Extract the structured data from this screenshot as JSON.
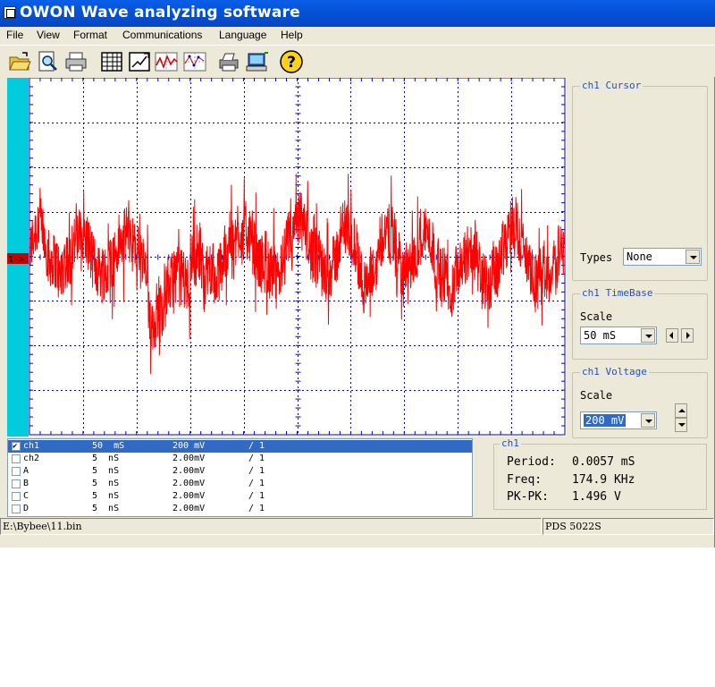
{
  "window": {
    "title": "OWON Wave analyzing software"
  },
  "menu": [
    "File",
    "View",
    "Format",
    "Communications",
    "Language",
    "Help"
  ],
  "toolbar": [
    {
      "icon": "open-folder-icon"
    },
    {
      "icon": "zoom-preview-icon"
    },
    {
      "icon": "printer-icon"
    },
    {
      "icon": "table-icon"
    },
    {
      "icon": "edit-chart-icon"
    },
    {
      "icon": "waveform-icon"
    },
    {
      "icon": "waveform-points-icon"
    },
    {
      "icon": "print-setup-icon"
    },
    {
      "icon": "device-connect-icon"
    },
    {
      "icon": "help-icon"
    }
  ],
  "scope": {
    "channel_marker": "1->",
    "trace_color": "#ff0000",
    "grid_color": "#0000cc",
    "left_bar_color": "#00ccdd"
  },
  "cursor_panel": {
    "title": "ch1 Cursor",
    "types_label": "Types",
    "types_value": "None"
  },
  "timebase_panel": {
    "title": "ch1 TimeBase",
    "scale_label": "Scale",
    "scale_value": "50 mS"
  },
  "voltage_panel": {
    "title": "ch1 Voltage",
    "scale_label": "Scale",
    "scale_value": "200 mV"
  },
  "channels": [
    {
      "name": "ch1",
      "time": "50  mS",
      "volt": "200 mV",
      "probe": "/ 1",
      "checked": true,
      "selected": true
    },
    {
      "name": "ch2",
      "time": "5  nS",
      "volt": "2.00mV",
      "probe": "/ 1",
      "checked": false,
      "selected": false
    },
    {
      "name": "A",
      "time": "5  nS",
      "volt": "2.00mV",
      "probe": "/ 1",
      "checked": false,
      "selected": false
    },
    {
      "name": "B",
      "time": "5  nS",
      "volt": "2.00mV",
      "probe": "/ 1",
      "checked": false,
      "selected": false
    },
    {
      "name": "C",
      "time": "5  nS",
      "volt": "2.00mV",
      "probe": "/ 1",
      "checked": false,
      "selected": false
    },
    {
      "name": "D",
      "time": "5  nS",
      "volt": "2.00mV",
      "probe": "/ 1",
      "checked": false,
      "selected": false
    }
  ],
  "measurements": {
    "title": "ch1",
    "period_label": "Period:",
    "period_value": "0.0057 mS",
    "freq_label": "Freq:",
    "freq_value": "174.9 KHz",
    "pkpk_label": "PK-PK:",
    "pkpk_value": "1.496 V"
  },
  "statusbar": {
    "file_path": "E:\\Bybee\\11.bin",
    "device": "PDS 5022S"
  }
}
